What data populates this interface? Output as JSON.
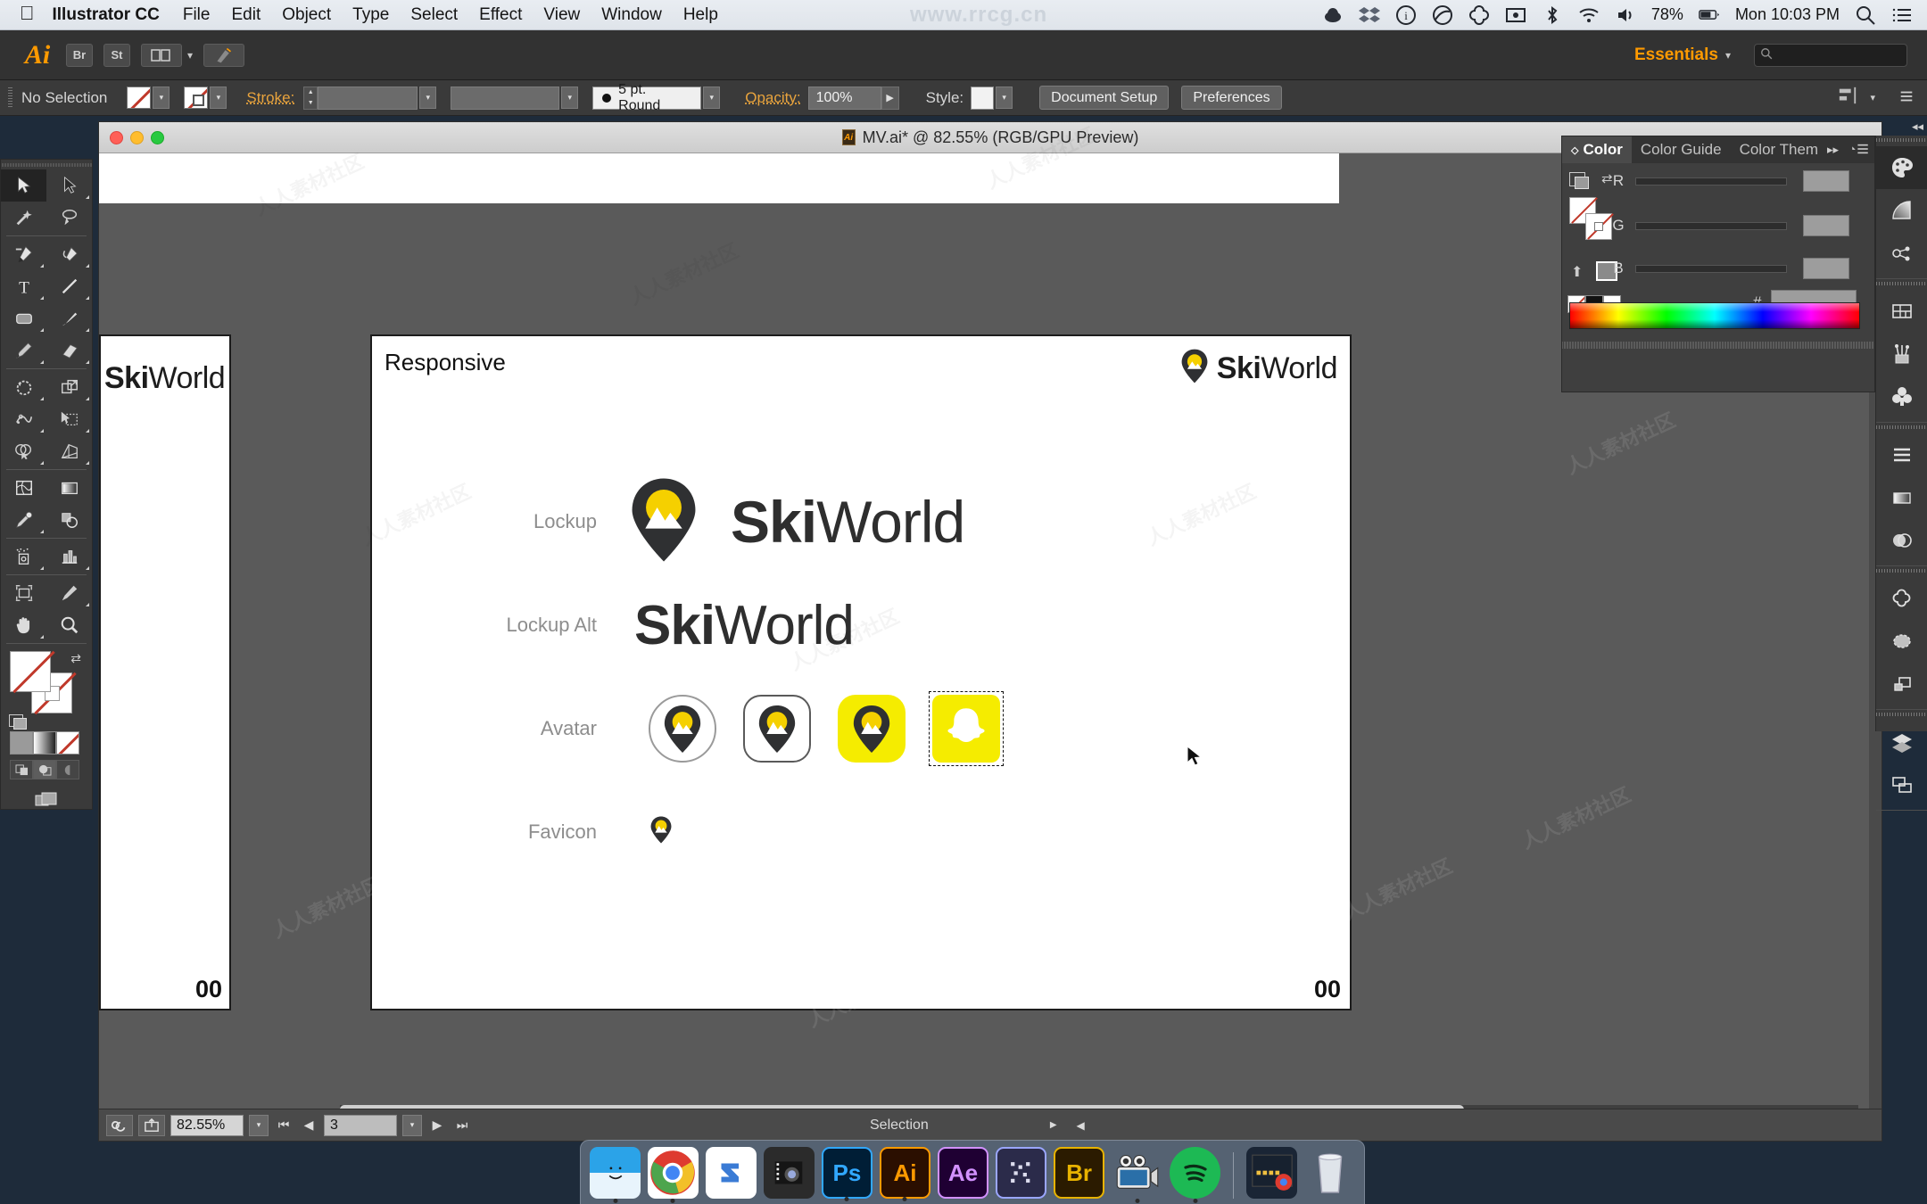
{
  "menubar": {
    "apple_icon": "apple-icon",
    "app_name": "Illustrator CC",
    "items": [
      "File",
      "Edit",
      "Object",
      "Type",
      "Select",
      "Effect",
      "View",
      "Window",
      "Help"
    ],
    "watermark": "www.rrcg.cn",
    "right_icons": [
      "user-icon",
      "dropbox-icon",
      "info-circle-icon",
      "moon-icon",
      "creative-cloud-icon",
      "screenshot-icon",
      "bluetooth-icon",
      "wifi-icon",
      "volume-icon"
    ],
    "battery_percent": "78%",
    "clock": "Mon 10:03 PM",
    "search_icon": "search-icon",
    "control-center-icon": "list-icon"
  },
  "appbar": {
    "ai_logo": "Ai",
    "bridge_label": "Br",
    "stock_label": "St",
    "arrange_icon": "arrange-documents-icon",
    "arrange_caret": "▾",
    "brush_icon": "brush-icon",
    "workspace": "Essentials",
    "workspace_caret": "▾",
    "search_placeholder": "",
    "search_icon": "search-icon"
  },
  "controlbar": {
    "selection_status": "No Selection",
    "fill_swatch": "none-fill-swatch",
    "stroke_swatch": "none-stroke-swatch",
    "stroke_label": "Stroke:",
    "stroke_weight": "",
    "stroke_profile": "",
    "brush_definition": "5 pt. Round",
    "opacity_label": "Opacity:",
    "opacity_value": "100%",
    "style_label": "Style:",
    "document_setup": "Document Setup",
    "preferences": "Preferences",
    "align_icon": "align-icon",
    "align_caret": "▾",
    "panel_menu_icon": "panel-menu-icon"
  },
  "toolbar": {
    "tools": [
      {
        "name": "selection-tool",
        "active": true
      },
      {
        "name": "direct-selection-tool",
        "active": false
      },
      {
        "name": "magic-wand-tool",
        "active": false
      },
      {
        "name": "lasso-tool",
        "active": false
      },
      {
        "name": "pen-tool",
        "active": false
      },
      {
        "name": "curvature-tool",
        "active": false
      },
      {
        "name": "type-tool",
        "active": false
      },
      {
        "name": "line-segment-tool",
        "active": false
      },
      {
        "name": "rectangle-tool",
        "active": false
      },
      {
        "name": "paintbrush-tool",
        "active": false
      },
      {
        "name": "pencil-tool",
        "active": false
      },
      {
        "name": "eraser-tool",
        "active": false
      },
      {
        "name": "rotate-tool",
        "active": false
      },
      {
        "name": "scale-tool",
        "active": false
      },
      {
        "name": "width-tool",
        "active": false
      },
      {
        "name": "free-transform-tool",
        "active": false
      },
      {
        "name": "shape-builder-tool",
        "active": false
      },
      {
        "name": "perspective-grid-tool",
        "active": false
      },
      {
        "name": "mesh-tool",
        "active": false
      },
      {
        "name": "gradient-tool",
        "active": false
      },
      {
        "name": "eyedropper-tool",
        "active": false
      },
      {
        "name": "blend-tool",
        "active": false
      },
      {
        "name": "symbol-sprayer-tool",
        "active": false
      },
      {
        "name": "column-graph-tool",
        "active": false
      },
      {
        "name": "artboard-tool",
        "active": false
      },
      {
        "name": "slice-tool",
        "active": false
      },
      {
        "name": "hand-tool",
        "active": false
      },
      {
        "name": "zoom-tool",
        "active": false
      }
    ],
    "fill_swatch": "none-fill-swatch",
    "stroke_swatch": "none-stroke-swatch",
    "swap_icon": "swap-fill-stroke-icon",
    "default_icon": "default-fill-stroke-icon",
    "color_mode": "color-mode-button",
    "gradient_mode": "gradient-mode-button",
    "none_mode": "none-mode-button",
    "draw_normal": "draw-normal-button",
    "draw_behind": "draw-behind-button",
    "draw_inside": "draw-inside-button",
    "screen_mode": "change-screen-mode-button"
  },
  "document": {
    "title": "MV.ai* @ 82.55% (RGB/GPU Preview)",
    "file_icon": "illustrator-file-icon",
    "close_button": "close-window-button",
    "minimize_button": "minimize-window-button",
    "zoom_button": "maximize-window-button"
  },
  "artboard_left": {
    "wordmark_bold": "Ski",
    "wordmark_light": "World",
    "number": "00"
  },
  "artboard_main": {
    "title": "Responsive",
    "header_logo_bold": "Ski",
    "header_logo_light": "World",
    "header_mark": "skiworld-pin-logo",
    "number": "00",
    "rows": [
      {
        "label": "Lockup",
        "mark": "skiworld-pin-logo",
        "wordmark_bold": "Ski",
        "wordmark_light": "World"
      },
      {
        "label": "Lockup Alt",
        "wordmark_bold": "Ski",
        "wordmark_light": "World"
      },
      {
        "label": "Avatar",
        "avatars": [
          {
            "name": "avatar-circle-outline",
            "style": "circle"
          },
          {
            "name": "avatar-rounded-square-outline",
            "style": "rounded"
          },
          {
            "name": "avatar-yellow-rounded-square",
            "style": "yellow"
          },
          {
            "name": "avatar-snapcode-ghost",
            "style": "snap"
          }
        ]
      },
      {
        "label": "Favicon",
        "mark": "skiworld-pin-logo-small"
      }
    ]
  },
  "statusbar": {
    "settings_icon": "document-settings-icon",
    "share_icon": "share-icon",
    "zoom_value": "82.55%",
    "zoom_caret": "▾",
    "first_artboard": "⏮",
    "prev_artboard": "◀",
    "artboard_number": "3",
    "artboard_caret": "▾",
    "next_artboard": "▶",
    "last_artboard": "⏭",
    "status_text": "Selection",
    "status_caret": "▶",
    "scroll_left": "◀"
  },
  "color_panel": {
    "tabs": [
      {
        "label": "Color",
        "active": true
      },
      {
        "label": "Color Guide",
        "active": false
      },
      {
        "label": "Color Them",
        "active": false
      }
    ],
    "collapse_icon": "collapse-panel-icon",
    "menu_icon": "panel-options-icon",
    "channels": [
      {
        "label": "R",
        "value": ""
      },
      {
        "label": "G",
        "value": ""
      },
      {
        "label": "B",
        "value": ""
      }
    ],
    "hex_label": "#",
    "hex_value": "",
    "spectrum": "color-spectrum-ramp",
    "fill_swatch": "none-fill-swatch",
    "stroke_swatch": "none-stroke-swatch"
  },
  "panel_dock": {
    "groups": [
      [
        "swatches-panel-icon",
        "gradient-panel-icon",
        "stroke-panel-icon"
      ],
      [
        "artboards-panel-icon",
        "brushes-panel-icon",
        "symbols-panel-icon"
      ],
      [
        "align-panel-icon",
        "transparency-panel-icon",
        "pathfinder-panel-icon"
      ],
      [
        "libraries-panel-icon",
        "appearance-panel-icon",
        "graphic-styles-panel-icon"
      ],
      [
        "layers-panel-icon",
        "artboard-panel-icon"
      ]
    ]
  },
  "dock": {
    "apps": [
      {
        "name": "finder",
        "label": "",
        "bg": "#2ba3e8",
        "running": true
      },
      {
        "name": "google-chrome",
        "label": "",
        "bg": "#ffffff",
        "running": true
      },
      {
        "name": "sketch-like-app",
        "label": "",
        "bg": "#ffffff",
        "running": false
      },
      {
        "name": "media-encoder",
        "label": "",
        "bg": "#2b2b2b",
        "running": false
      },
      {
        "name": "photoshop",
        "label": "Ps",
        "bg": "#001e36",
        "running": true
      },
      {
        "name": "illustrator",
        "label": "Ai",
        "bg": "#2b0f00",
        "running": true
      },
      {
        "name": "after-effects",
        "label": "Ae",
        "bg": "#1f0033",
        "running": false
      },
      {
        "name": "media-tool",
        "label": "",
        "bg": "#2b2b4a",
        "running": false
      },
      {
        "name": "bridge",
        "label": "Br",
        "bg": "#2b1b00",
        "running": false
      },
      {
        "name": "quicktime-player",
        "label": "",
        "bg": "#3a8fd0",
        "running": true
      },
      {
        "name": "spotify",
        "label": "",
        "bg": "#1db954",
        "running": true
      },
      {
        "name": "separator",
        "label": "",
        "bg": "",
        "running": false
      },
      {
        "name": "downloads-stack",
        "label": "",
        "bg": "#1a2535",
        "running": false
      },
      {
        "name": "trash",
        "label": "",
        "bg": "#d8dde3",
        "running": false
      }
    ]
  },
  "watermarks": {
    "text": "人人素材社区"
  },
  "colors": {
    "brand_yellow": "#F5EC00",
    "brand_dark": "#2F3032",
    "accent_orange": "#FF9A00",
    "panel_bg": "#3A3A3A",
    "canvas_gray": "#5A5A5A"
  }
}
